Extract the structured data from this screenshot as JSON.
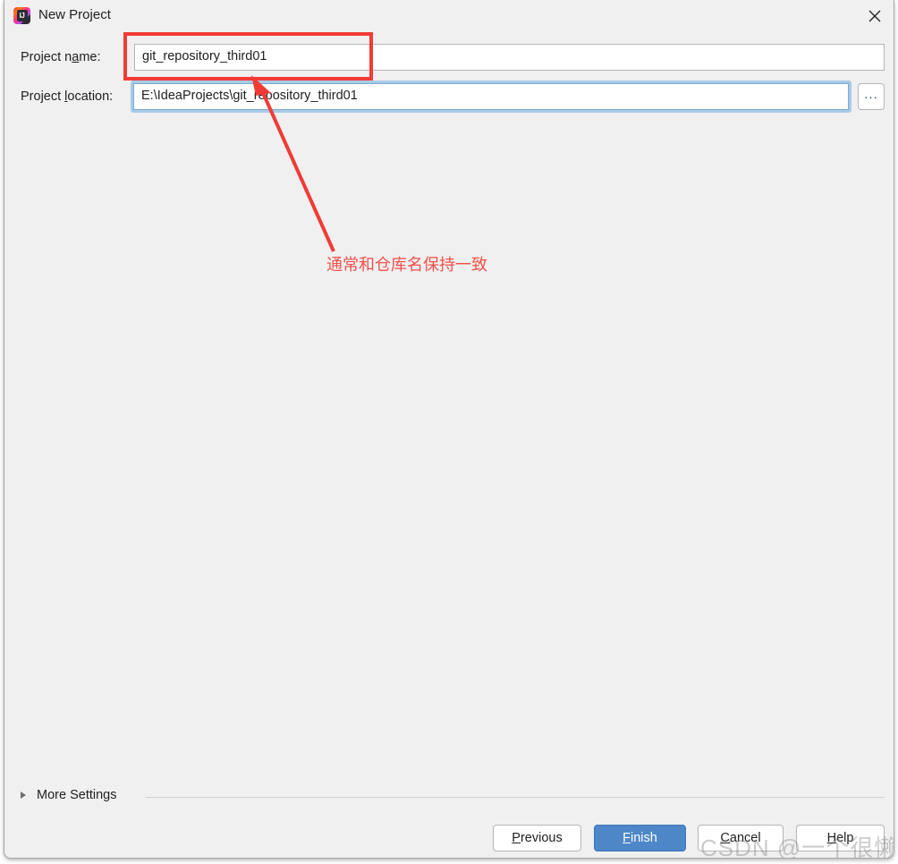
{
  "window": {
    "title": "New Project",
    "icon": "intellij-idea-icon",
    "close_icon": "close-icon"
  },
  "form": {
    "project_name": {
      "label_before": "Project n",
      "label_mnemonic": "a",
      "label_after": "me:",
      "value": "git_repository_third01"
    },
    "project_location": {
      "label_before": "Project ",
      "label_mnemonic": "l",
      "label_after": "ocation:",
      "value": "E:\\IdeaProjects\\git_repository_third01"
    },
    "browse_button_label": "..."
  },
  "more_settings": {
    "label_before": "Mor",
    "label_mnemonic": "e",
    "label_after": " Settings",
    "expanded": false,
    "arrow_icon": "chevron-right-icon"
  },
  "buttons": {
    "previous": {
      "before": "",
      "mnemonic": "P",
      "after": "revious"
    },
    "finish": {
      "before": "",
      "mnemonic": "F",
      "after": "inish"
    },
    "cancel": {
      "before": "",
      "mnemonic": "C",
      "after": "ancel"
    },
    "help": {
      "before": "",
      "mnemonic": "H",
      "after": "elp"
    }
  },
  "annotation": {
    "text": "通常和仓库名保持一致",
    "color": "#f2504a",
    "box_color": "#f23b35"
  },
  "watermark": {
    "text": "CSDN @一个很懒的人"
  },
  "colors": {
    "dialog_background": "#f0f0f0",
    "primary_button": "#4d87c7",
    "focus_ring": "#a8cbe8",
    "field_border": "#b5b5b5"
  }
}
